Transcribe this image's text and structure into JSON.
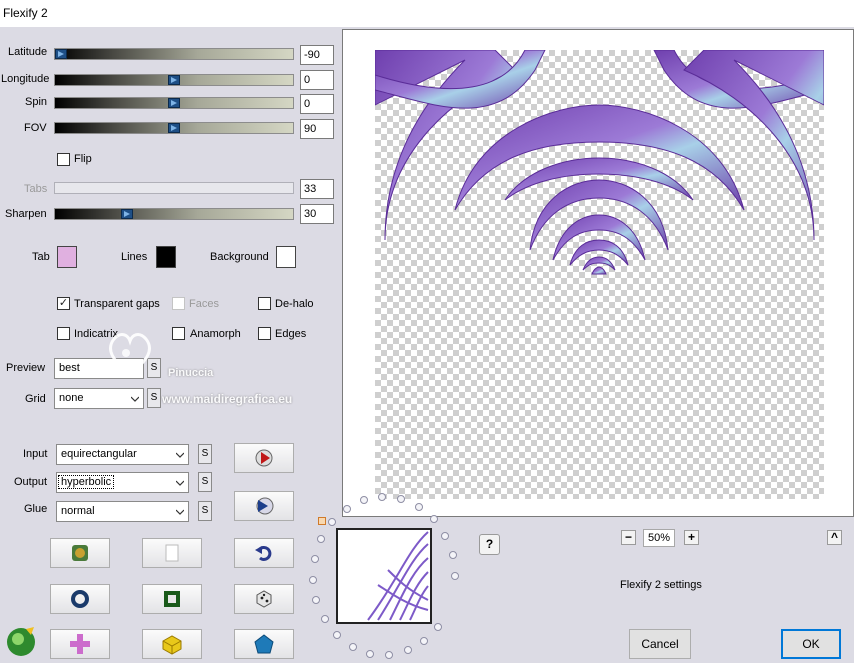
{
  "window": {
    "title": "Flexify 2"
  },
  "sliders": [
    {
      "label": "Latitude",
      "value": "-90",
      "position": 0.0,
      "enabled": true
    },
    {
      "label": "Longitude",
      "value": "0",
      "position": 0.5,
      "enabled": true
    },
    {
      "label": "Spin",
      "value": "0",
      "position": 0.5,
      "enabled": true
    },
    {
      "label": "FOV",
      "value": "90",
      "position": 0.5,
      "enabled": true
    },
    {
      "label": "Tabs",
      "value": "33",
      "position": null,
      "enabled": false
    },
    {
      "label": "Sharpen",
      "value": "30",
      "position": 0.3,
      "enabled": true
    }
  ],
  "flip": {
    "label": "Flip",
    "checked": false
  },
  "colors": {
    "tab": {
      "label": "Tab",
      "color": "#e0b0e0"
    },
    "lines": {
      "label": "Lines",
      "color": "#000000"
    },
    "background": {
      "label": "Background",
      "color": "#ffffff"
    }
  },
  "options": {
    "transparent_gaps": {
      "label": "Transparent gaps",
      "checked": true
    },
    "faces": {
      "label": "Faces",
      "checked": false,
      "enabled": false
    },
    "de_halo": {
      "label": "De-halo",
      "checked": false
    },
    "indicatrix": {
      "label": "Indicatrix",
      "checked": false
    },
    "anamorph": {
      "label": "Anamorph",
      "checked": false
    },
    "edges": {
      "label": "Edges",
      "checked": false
    }
  },
  "preview": {
    "label": "Preview",
    "value": "best",
    "s_label": "S"
  },
  "grid": {
    "label": "Grid",
    "value": "none",
    "s_label": "S"
  },
  "input": {
    "label": "Input",
    "value": "equirectangular",
    "s_label": "S"
  },
  "output": {
    "label": "Output",
    "value": "hyperbolic",
    "s_label": "S"
  },
  "glue": {
    "label": "Glue",
    "value": "normal",
    "s_label": "S"
  },
  "watermark": {
    "line1": "Pinuccia",
    "line2": "www.maidiregrafica.eu"
  },
  "zoom": {
    "minus": "−",
    "value": "50%",
    "plus": "+"
  },
  "help_label": "?",
  "collapse_label": "^",
  "settings_name": "Flexify 2 settings",
  "buttons": {
    "cancel": "Cancel",
    "ok": "OK"
  },
  "icons": {
    "render": "render-icon",
    "play": "play-icon",
    "undo": "undo-icon",
    "planet": "planet-icon",
    "copy": "copy-icon",
    "ring": "ring-icon",
    "frame": "frame-icon",
    "dice": "dice-icon",
    "logo": "logo-icon",
    "cross": "cross-icon",
    "cube": "cube-icon",
    "pentagon": "pentagon-icon"
  },
  "accent": "#0078d7",
  "art_colors": {
    "purple": "#7b4bb8",
    "light": "#a8d0e8"
  }
}
